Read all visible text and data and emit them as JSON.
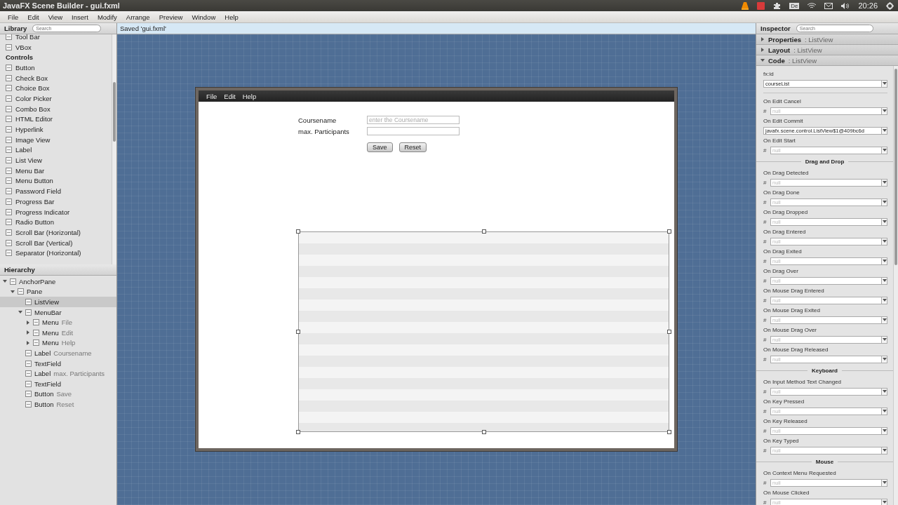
{
  "os_bar": {
    "title": "JavaFX Scene Builder - gui.fxml",
    "keyboard": "De",
    "clock": "20:26"
  },
  "menu": [
    "File",
    "Edit",
    "View",
    "Insert",
    "Modify",
    "Arrange",
    "Preview",
    "Window",
    "Help"
  ],
  "library": {
    "title": "Library",
    "search_placeholder": "Search",
    "items": [
      {
        "kind": "item",
        "label": "Tool Bar"
      },
      {
        "kind": "item",
        "label": "VBox"
      },
      {
        "kind": "heading",
        "label": "Controls"
      },
      {
        "kind": "item",
        "label": "Button"
      },
      {
        "kind": "item",
        "label": "Check Box"
      },
      {
        "kind": "item",
        "label": "Choice Box"
      },
      {
        "kind": "item",
        "label": "Color Picker"
      },
      {
        "kind": "item",
        "label": "Combo Box"
      },
      {
        "kind": "item",
        "label": "HTML Editor"
      },
      {
        "kind": "item",
        "label": "Hyperlink"
      },
      {
        "kind": "item",
        "label": "Image View"
      },
      {
        "kind": "item",
        "label": "Label"
      },
      {
        "kind": "item",
        "label": "List View"
      },
      {
        "kind": "item",
        "label": "Menu Bar"
      },
      {
        "kind": "item",
        "label": "Menu Button"
      },
      {
        "kind": "item",
        "label": "Password Field"
      },
      {
        "kind": "item",
        "label": "Progress Bar"
      },
      {
        "kind": "item",
        "label": "Progress Indicator"
      },
      {
        "kind": "item",
        "label": "Radio Button"
      },
      {
        "kind": "item",
        "label": "Scroll Bar (Horizontal)"
      },
      {
        "kind": "item",
        "label": "Scroll Bar (Vertical)"
      },
      {
        "kind": "item",
        "label": "Separator (Horizontal)"
      }
    ]
  },
  "status": "Saved 'gui.fxml'",
  "hierarchy": {
    "title": "Hierarchy",
    "tree": [
      {
        "type": "AnchorPane",
        "selected": false,
        "expanded": true,
        "children": [
          {
            "type": "Pane",
            "selected": false,
            "expanded": true,
            "children": [
              {
                "type": "ListView",
                "selected": true
              },
              {
                "type": "MenuBar",
                "selected": false,
                "expanded": true,
                "children": [
                  {
                    "type": "Menu",
                    "name": "File",
                    "selected": false,
                    "expanded": false
                  },
                  {
                    "type": "Menu",
                    "name": "Edit",
                    "selected": false,
                    "expanded": false
                  },
                  {
                    "type": "Menu",
                    "name": "Help",
                    "selected": false,
                    "expanded": false
                  }
                ]
              },
              {
                "type": "Label",
                "name": "Coursename",
                "selected": false
              },
              {
                "type": "TextField",
                "selected": false
              },
              {
                "type": "Label",
                "name": "max. Participants",
                "selected": false
              },
              {
                "type": "TextField",
                "selected": false
              },
              {
                "type": "Button",
                "name": "Save",
                "selected": false
              },
              {
                "type": "Button",
                "name": "Reset",
                "selected": false
              }
            ]
          }
        ]
      }
    ]
  },
  "scene": {
    "menus": [
      "File",
      "Edit",
      "Help"
    ],
    "form": [
      {
        "label": "Coursename",
        "placeholder": "enter the Coursename"
      },
      {
        "label": "max. Participants"
      }
    ],
    "buttons": [
      "Save",
      "Reset"
    ]
  },
  "inspector": {
    "title": "Inspector",
    "search_placeholder": "Search",
    "sections": [
      {
        "title": "Properties",
        "subject": ": ListView",
        "expanded": false
      },
      {
        "title": "Layout",
        "subject": ": ListView",
        "expanded": false
      },
      {
        "title": "Code",
        "subject": ": ListView",
        "expanded": true
      }
    ],
    "fields": [
      {
        "kind": "field",
        "label": "fx:id",
        "value": "courseList"
      },
      {
        "kind": "field",
        "label": "On Edit Cancel",
        "prefix": "#",
        "placeholder": "null"
      },
      {
        "kind": "field",
        "label": "On Edit Commit",
        "value": "javafx.scene.control.ListView$1@409bc6d"
      },
      {
        "kind": "field",
        "label": "On Edit Start",
        "prefix": "#",
        "placeholder": "null"
      },
      {
        "kind": "heading",
        "label": "Drag and Drop"
      },
      {
        "kind": "field",
        "label": "On Drag Detected",
        "prefix": "#",
        "placeholder": "null"
      },
      {
        "kind": "field",
        "label": "On Drag Done",
        "prefix": "#",
        "placeholder": "null"
      },
      {
        "kind": "field",
        "label": "On Drag Dropped",
        "prefix": "#",
        "placeholder": "null"
      },
      {
        "kind": "field",
        "label": "On Drag Entered",
        "prefix": "#",
        "placeholder": "null"
      },
      {
        "kind": "field",
        "label": "On Drag Exited",
        "prefix": "#",
        "placeholder": "null"
      },
      {
        "kind": "field",
        "label": "On Drag Over",
        "prefix": "#",
        "placeholder": "null"
      },
      {
        "kind": "field",
        "label": "On Mouse Drag Entered",
        "prefix": "#",
        "placeholder": "null"
      },
      {
        "kind": "field",
        "label": "On Mouse Drag Exited",
        "prefix": "#",
        "placeholder": "null"
      },
      {
        "kind": "field",
        "label": "On Mouse Drag Over",
        "prefix": "#",
        "placeholder": "null"
      },
      {
        "kind": "field",
        "label": "On Mouse Drag Released",
        "prefix": "#",
        "placeholder": "null"
      },
      {
        "kind": "heading",
        "label": "Keyboard"
      },
      {
        "kind": "field",
        "label": "On Input Method Text Changed",
        "prefix": "#",
        "placeholder": "null"
      },
      {
        "kind": "field",
        "label": "On Key Pressed",
        "prefix": "#",
        "placeholder": "null"
      },
      {
        "kind": "field",
        "label": "On Key Released",
        "prefix": "#",
        "placeholder": "null"
      },
      {
        "kind": "field",
        "label": "On Key Typed",
        "prefix": "#",
        "placeholder": "null"
      },
      {
        "kind": "heading",
        "label": "Mouse"
      },
      {
        "kind": "field",
        "label": "On Context Menu Requested",
        "prefix": "#",
        "placeholder": "null"
      },
      {
        "kind": "field",
        "label": "On Mouse Clicked",
        "prefix": "#",
        "placeholder": "null"
      }
    ]
  }
}
